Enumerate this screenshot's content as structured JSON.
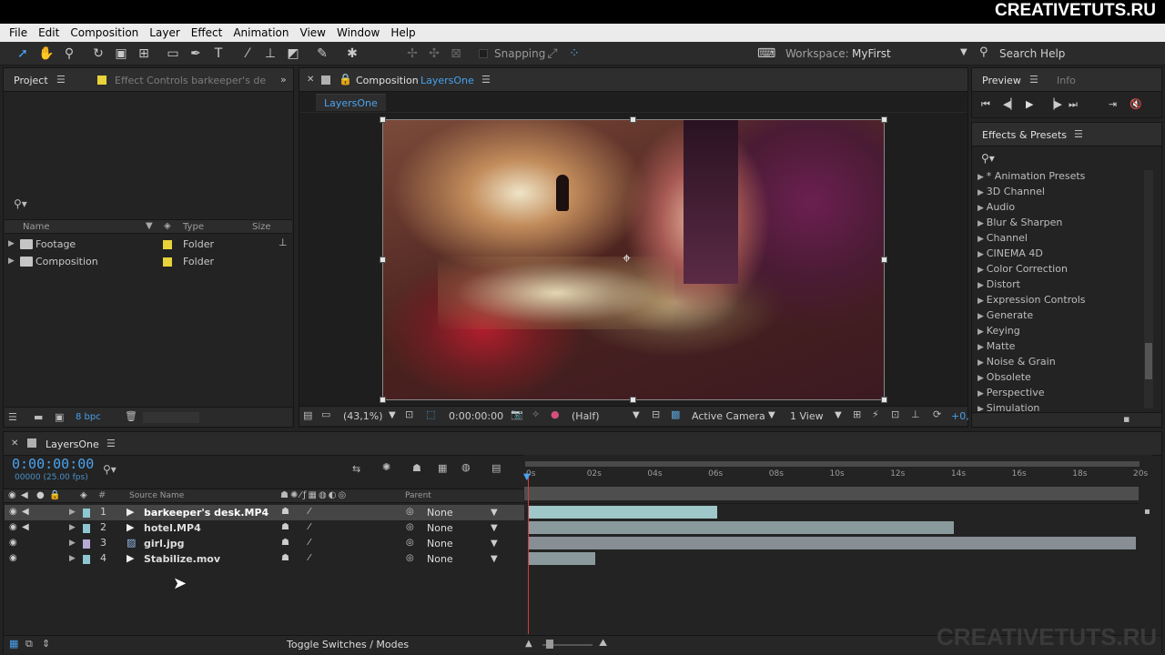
{
  "brand": "CREATIVETUTS.RU",
  "menu": [
    "File",
    "Edit",
    "Composition",
    "Layer",
    "Effect",
    "Animation",
    "View",
    "Window",
    "Help"
  ],
  "toolbar": {
    "snapping": "Snapping",
    "workspace_label": "Workspace:",
    "workspace_value": "MyFirst",
    "search_help": "Search Help"
  },
  "project": {
    "tab": "Project",
    "effect_controls_tab": "Effect Controls barkeeper's de",
    "cols": {
      "name": "Name",
      "type": "Type",
      "size": "Size"
    },
    "items": [
      {
        "name": "Footage",
        "type": "Folder"
      },
      {
        "name": "Composition",
        "type": "Folder"
      }
    ],
    "bpc": "8 bpc"
  },
  "composition": {
    "tab_prefix": "Composition",
    "tab_name": "LayersOne",
    "sub_tab": "LayersOne",
    "footer": {
      "zoom": "(43,1%)",
      "timecode": "0:00:00:00",
      "resolution": "(Half)",
      "camera": "Active Camera",
      "views": "1 View",
      "exposure": "+0,"
    }
  },
  "preview": {
    "tab": "Preview",
    "info_tab": "Info"
  },
  "effects": {
    "tab": "Effects & Presets",
    "items": [
      "* Animation Presets",
      "3D Channel",
      "Audio",
      "Blur & Sharpen",
      "Channel",
      "CINEMA 4D",
      "Color Correction",
      "Distort",
      "Expression Controls",
      "Generate",
      "Keying",
      "Matte",
      "Noise & Grain",
      "Obsolete",
      "Perspective",
      "Simulation"
    ]
  },
  "timeline": {
    "tab": "LayersOne",
    "timecode": "0:00:00:00",
    "fps": "00000 (25.00 fps)",
    "cols": {
      "source": "Source Name",
      "parent": "Parent"
    },
    "ruler": [
      "0s",
      "02s",
      "04s",
      "06s",
      "08s",
      "10s",
      "12s",
      "14s",
      "16s",
      "18s",
      "20s"
    ],
    "layers": [
      {
        "num": "1",
        "name": "barkeeper's desk.MP4",
        "parent": "None",
        "color": "#8ec7cf",
        "end": 0.31
      },
      {
        "num": "2",
        "name": "hotel.MP4",
        "parent": "None",
        "color": "#8ec7cf",
        "end": 0.7
      },
      {
        "num": "3",
        "name": "girl.jpg",
        "parent": "None",
        "color": "#b7a9d6",
        "end": 1.0
      },
      {
        "num": "4",
        "name": "Stabilize.mov",
        "parent": "None",
        "color": "#8ec7cf",
        "end": 0.11
      }
    ],
    "toggle": "Toggle Switches / Modes"
  },
  "watermark": "CREATIVETUTS.RU"
}
